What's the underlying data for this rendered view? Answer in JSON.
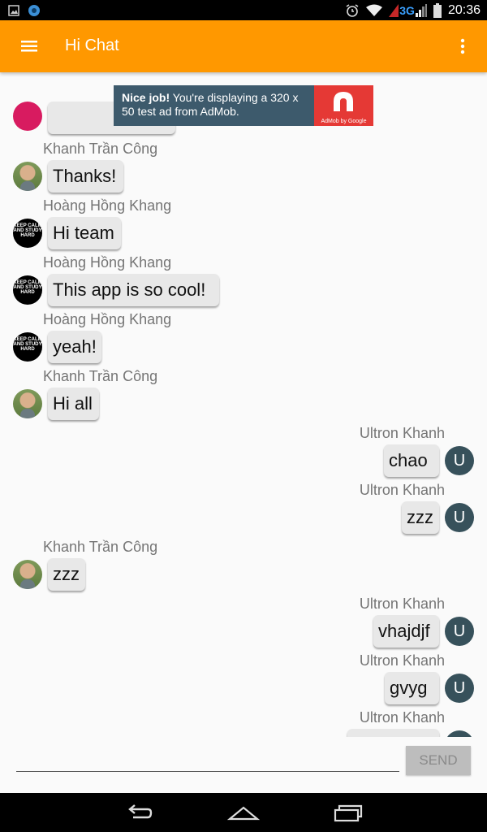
{
  "status_bar": {
    "network": "3G",
    "time": "20:36",
    "icons": [
      "image-icon",
      "app-icon",
      "alarm-icon",
      "wifi-icon",
      "signal-icon",
      "battery-icon"
    ]
  },
  "app_bar": {
    "title": "Hi Chat",
    "color": "#ff9800",
    "icons": [
      "menu-icon",
      "overflow-menu-icon"
    ]
  },
  "ad": {
    "bold_text": "Nice job!",
    "text": " You're displaying a 320 x 50 test ad from AdMob.",
    "logo_caption": "AdMob by Google",
    "background": "#3d5a6c",
    "logo_color": "#e53935"
  },
  "messages": [
    {
      "sender": "Khanh Trần Công",
      "text": "Thanks!",
      "avatar": "photo",
      "side": "left"
    },
    {
      "sender": "Hoàng Hồng Khang",
      "text": "Hi team",
      "avatar": "keep-calm",
      "side": "left"
    },
    {
      "sender": "Hoàng Hồng Khang",
      "text": "This app is so cool!",
      "avatar": "keep-calm",
      "side": "left"
    },
    {
      "sender": "Hoàng Hồng Khang",
      "text": "yeah!",
      "avatar": "keep-calm",
      "side": "left"
    },
    {
      "sender": "Khanh Trần Công",
      "text": "Hi all",
      "avatar": "photo",
      "side": "left"
    },
    {
      "sender": "Ultron Khanh",
      "text": "chao",
      "avatar": "U",
      "side": "right"
    },
    {
      "sender": "Ultron Khanh",
      "text": "zzz",
      "avatar": "U",
      "side": "right"
    },
    {
      "sender": "Khanh Trần Công",
      "text": "zzz",
      "avatar": "photo",
      "side": "left"
    },
    {
      "sender": "Ultron Khanh",
      "text": "vhajdjf",
      "avatar": "U",
      "side": "right"
    },
    {
      "sender": "Ultron Khanh",
      "text": "gvyg",
      "avatar": "U",
      "side": "right"
    },
    {
      "sender": "Ultron Khanh",
      "text": "",
      "avatar": "U",
      "side": "right"
    }
  ],
  "avatar_keep_calm_text": "KEEP CALM AND STUDY HARD",
  "avatar_u_letter": "U",
  "input": {
    "placeholder": "",
    "value": "",
    "send_label": "SEND"
  },
  "nav_bar": {
    "icons": [
      "back-icon",
      "home-icon",
      "recents-icon"
    ]
  }
}
